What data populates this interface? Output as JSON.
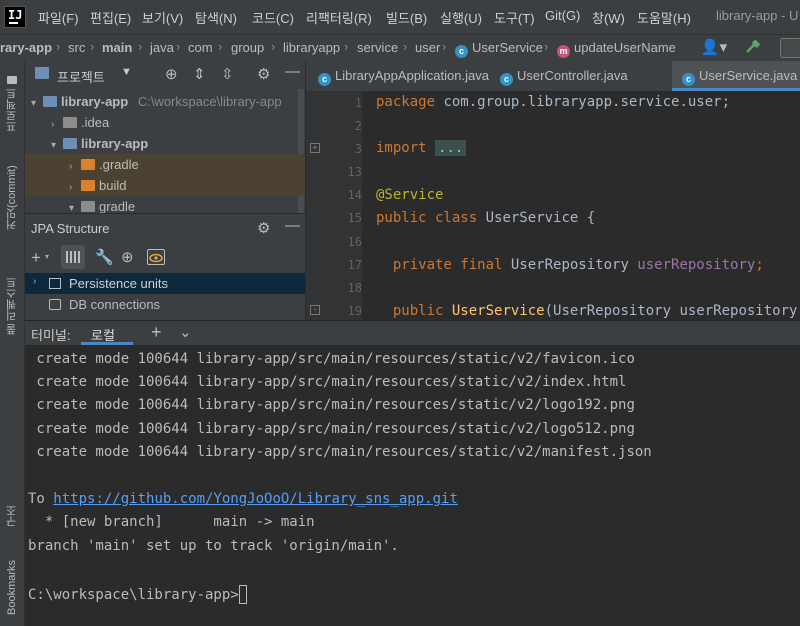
{
  "menu": {
    "items": [
      "파일(F)",
      "편집(E)",
      "보기(V)",
      "탐색(N)",
      "코드(C)",
      "리팩터링(R)",
      "빌드(B)",
      "실행(U)",
      "도구(T)",
      "Git(G)",
      "창(W)",
      "도움말(H)"
    ],
    "window_title": "library-app - U"
  },
  "breadcrumb": [
    "rary-app",
    "src",
    "main",
    "java",
    "com",
    "group",
    "libraryapp",
    "service",
    "user",
    "UserService",
    "updateUserName"
  ],
  "left_strip": {
    "project": "프로젝트",
    "commit": "커밋(commit)",
    "pull_requests": "풀 리퀘스트",
    "structure": "구조",
    "bookmarks": "Bookmarks"
  },
  "project_panel": {
    "title": "프로젝트",
    "tree": [
      {
        "label": "library-app",
        "path": "C:\\workspace\\library-app",
        "expanded": true
      },
      {
        "label": ".idea"
      },
      {
        "label": "library-app",
        "expanded": true
      },
      {
        "label": ".gradle"
      },
      {
        "label": "build"
      },
      {
        "label": "gradle"
      }
    ]
  },
  "jpa_panel": {
    "title": "JPA Structure",
    "items": [
      "Persistence units",
      "DB connections"
    ]
  },
  "editor": {
    "tabs": [
      "LibraryAppApplication.java",
      "UserController.java",
      "UserService.java"
    ],
    "active_tab": "UserService.java",
    "line_numbers": [
      "1",
      "2",
      "3",
      "13",
      "14",
      "15",
      "16",
      "17",
      "18",
      "19"
    ],
    "code": {
      "package_kw": "package",
      "package_name": " com.group.libraryapp.service.user;",
      "import_kw": "import",
      "import_fold": "...",
      "annotation": "@Service",
      "class_line_kw": "public class",
      "class_name": " UserService {",
      "field_kw": "private final",
      "field_type": " UserRepository ",
      "field_name": "userRepository",
      "field_end": ";",
      "ctor_kw": "public",
      "ctor_name": "UserService",
      "ctor_params": "(UserRepository userRepository"
    }
  },
  "terminal": {
    "tab_label": "터미널:",
    "session_tab": "로컬",
    "lines": [
      " create mode 100644 library-app/src/main/resources/static/v2/favicon.ico",
      " create mode 100644 library-app/src/main/resources/static/v2/index.html",
      " create mode 100644 library-app/src/main/resources/static/v2/logo192.png",
      " create mode 100644 library-app/src/main/resources/static/v2/logo512.png",
      " create mode 100644 library-app/src/main/resources/static/v2/manifest.json"
    ],
    "to_prefix": "To ",
    "remote_url": "https://github.com/YongJoOoO/Library_sns_app.git",
    "branch_line": "  * [new branch]      main -> main",
    "track_line": "branch 'main' set up to track 'origin/main'.",
    "prompt": "C:\\workspace\\library-app>"
  }
}
